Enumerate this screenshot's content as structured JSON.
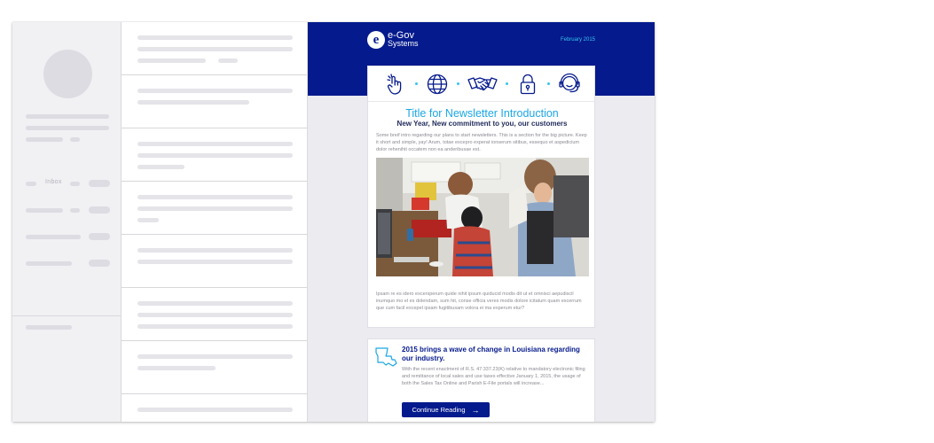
{
  "sidebar": {
    "inbox_label": "Inbox"
  },
  "email": {
    "brand": {
      "name_line1": "e-Gov",
      "name_line2": "Systems",
      "mark": "e"
    },
    "date": "February 2015",
    "icons": [
      "touch-gesture-icon",
      "globe-icon",
      "handshake-icon",
      "padlock-icon",
      "headset-support-icon"
    ],
    "intro": {
      "title": "Title for Newsletter Introduction",
      "subtitle": "New Year, New commitment to you, our customers",
      "body": "Some breif intro regarding our plans to start newsletters. This is a section for the big picture. Keep it short and simple, yay! Arum, totae excepro experat ionserum sitibus, essequo et aspedicium dolor rehenihit occatem non ea anderibusae est.",
      "outro": "Ipsam re es idero excersperum quide nihit ipsum quiducid modis dit ut et omnisci aepudiscil inumquo mo el es dolendam, sum hit, conse officia veres modis dolore icitatum quam excerrum que cum facil excepel ipsam fugitibusam volora ei ma experum etur?"
    },
    "news": {
      "icon": "louisiana-map-icon",
      "title": "2015 brings a wave of change in Louisiana regarding our industry.",
      "body": "With the recent enactment of R.S. 47:337.23(K) relative to mandatory electronic filing and remittance of local sales and use taxes effective January 1, 2015, the usage of both the Sales Tax Online and Parish E-File portals will increase...",
      "button_label": "Continue Reading",
      "button_arrow": "→"
    }
  },
  "colors": {
    "header_blue": "#051a8c",
    "accent_cyan": "#1ba7e3",
    "date_cyan": "#36c3f0"
  }
}
